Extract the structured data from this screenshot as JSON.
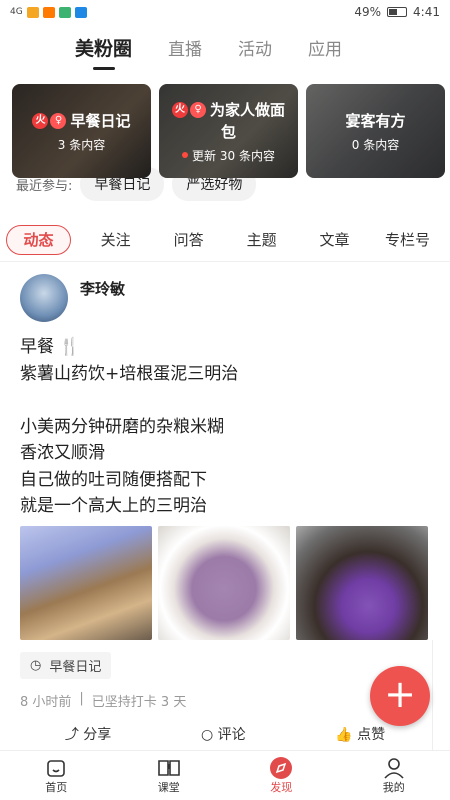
{
  "statusbar": {
    "battery": "49%",
    "time": "4:41",
    "network": "4G"
  },
  "topnav": {
    "tabs": [
      "美粉圈",
      "直播",
      "活动",
      "应用"
    ],
    "active": 0
  },
  "cards": [
    {
      "title": "早餐日记",
      "sub": "3 条内容",
      "has_badges": true,
      "update_dot": false
    },
    {
      "title": "为家人做面包",
      "sub": "更新 30 条内容",
      "has_badges": true,
      "update_dot": true
    },
    {
      "title": "宴客有方",
      "sub": "0 条内容",
      "has_badges": false,
      "update_dot": false
    }
  ],
  "recent": {
    "label": "最近参与:",
    "tags": [
      "早餐日记",
      "严选好物"
    ]
  },
  "subtabs": [
    "动态",
    "关注",
    "问答",
    "主题",
    "文章",
    "专栏号"
  ],
  "post": {
    "author": "李玲敏",
    "lines": [
      "早餐 🍴",
      "紫薯山药饮+培根蛋泥三明治",
      "",
      "小美两分钟研磨的杂粮米糊",
      "香浓又顺滑",
      "自己做的吐司随便搭配下",
      "就是一个高大上的三明治"
    ],
    "topic": "早餐日记",
    "time": "8 小时前",
    "streak": "已坚持打卡 3 天",
    "actions": [
      "分享",
      "评论",
      "点赞"
    ]
  },
  "bottombar": [
    {
      "label": "首页",
      "icon": "home-icon"
    },
    {
      "label": "课堂",
      "icon": "book-icon"
    },
    {
      "label": "发现",
      "icon": "compass-icon"
    },
    {
      "label": "我的",
      "icon": "user-icon"
    }
  ],
  "colors": {
    "accent": "#e24b4b"
  }
}
